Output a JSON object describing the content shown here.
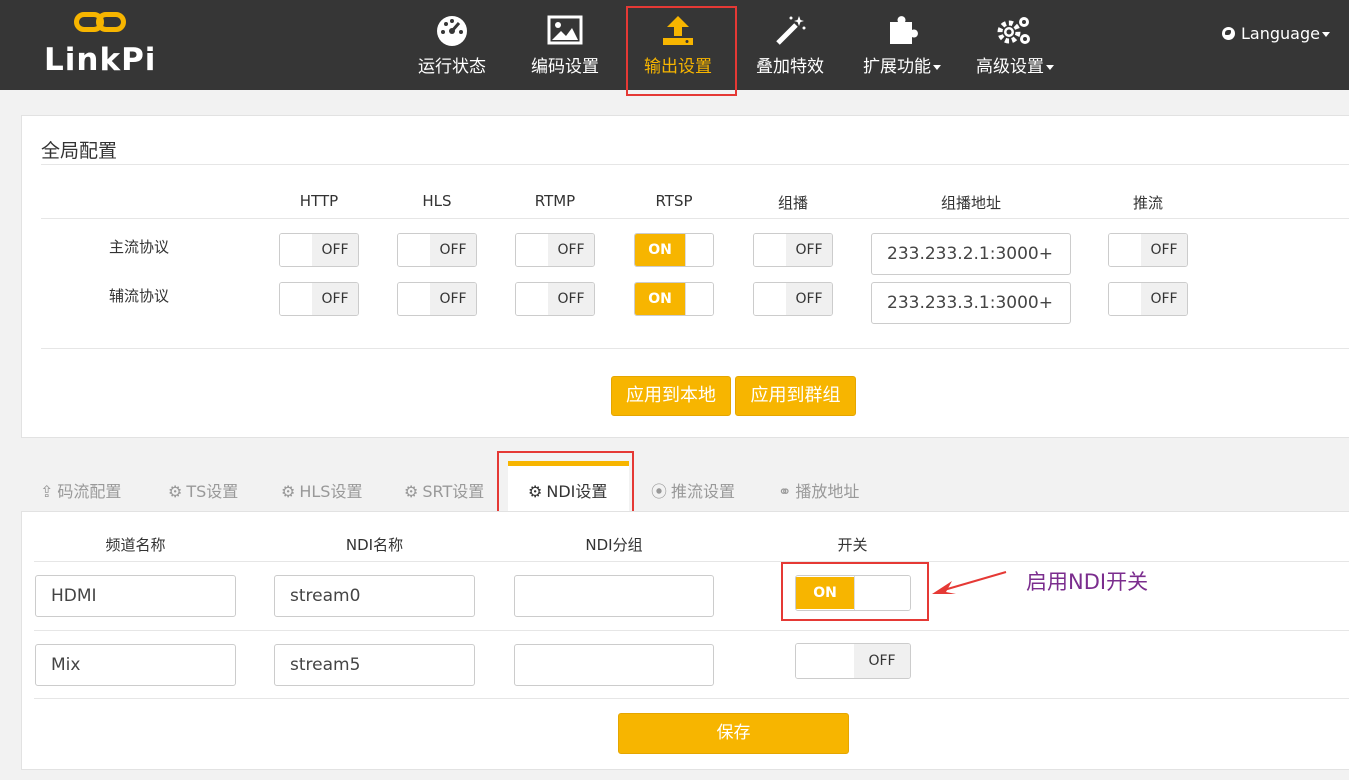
{
  "brand": {
    "name": "LinkPi",
    "logo_color": "#f7b500"
  },
  "nav": {
    "items": [
      {
        "label": "运行状态",
        "icon": "dashboard-icon",
        "active": false,
        "dropdown": false
      },
      {
        "label": "编码设置",
        "icon": "picture-icon",
        "active": false,
        "dropdown": false
      },
      {
        "label": "输出设置",
        "icon": "upload-icon",
        "active": true,
        "dropdown": false
      },
      {
        "label": "叠加特效",
        "icon": "magic-wand-icon",
        "active": false,
        "dropdown": false
      },
      {
        "label": "扩展功能",
        "icon": "puzzle-icon",
        "active": false,
        "dropdown": true
      },
      {
        "label": "高级设置",
        "icon": "gears-icon",
        "active": false,
        "dropdown": true
      }
    ],
    "language": "Language"
  },
  "global": {
    "title": "全局配置",
    "columns": [
      "HTTP",
      "HLS",
      "RTMP",
      "RTSP",
      "组播",
      "组播地址",
      "推流"
    ],
    "rows": [
      {
        "label": "主流协议",
        "http": "OFF",
        "hls": "OFF",
        "rtmp": "OFF",
        "rtsp": "ON",
        "multicast": "OFF",
        "multicast_addr": "233.233.2.1:3000+",
        "push": "OFF"
      },
      {
        "label": "辅流协议",
        "http": "OFF",
        "hls": "OFF",
        "rtmp": "OFF",
        "rtsp": "ON",
        "multicast": "OFF",
        "multicast_addr": "233.233.3.1:3000+",
        "push": "OFF"
      }
    ],
    "apply_local": "应用到本地",
    "apply_group": "应用到群组"
  },
  "tabs": [
    {
      "label": "码流配置",
      "icon": "upload-icon",
      "active": false
    },
    {
      "label": "TS设置",
      "icon": "gear-icon",
      "active": false
    },
    {
      "label": "HLS设置",
      "icon": "gear-icon",
      "active": false
    },
    {
      "label": "SRT设置",
      "icon": "gear-icon",
      "active": false
    },
    {
      "label": "NDI设置",
      "icon": "gear-icon",
      "active": true
    },
    {
      "label": "推流设置",
      "icon": "broadcast-icon",
      "active": false
    },
    {
      "label": "播放地址",
      "icon": "link-icon",
      "active": false
    }
  ],
  "ndi": {
    "columns": [
      "频道名称",
      "NDI名称",
      "NDI分组",
      "开关"
    ],
    "rows": [
      {
        "channel": "HDMI",
        "ndi_name": "stream0",
        "group": "",
        "switch": "ON"
      },
      {
        "channel": "Mix",
        "ndi_name": "stream5",
        "group": "",
        "switch": "OFF"
      }
    ],
    "save": "保存"
  },
  "annotation": {
    "text": "启用NDI开关",
    "color": "#7b2d8e"
  },
  "colors": {
    "accent": "#f7b500",
    "nav_bg": "#363636",
    "highlight_box": "#e53935"
  }
}
